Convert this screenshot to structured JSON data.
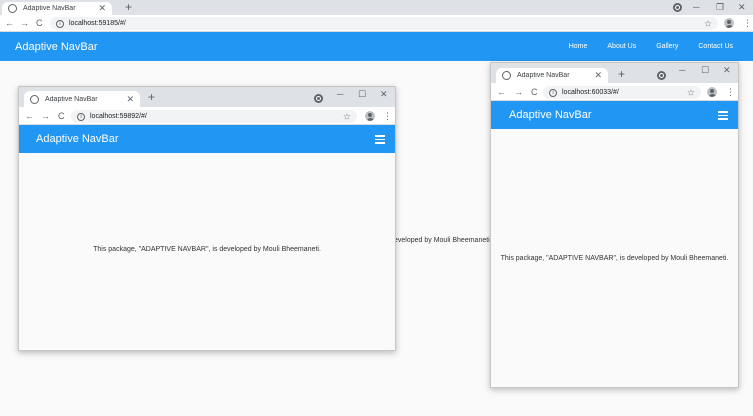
{
  "main": {
    "tab": {
      "title": "Adaptive NavBar",
      "close": "✕"
    },
    "new_tab": "+",
    "window_controls": {
      "minimize": "─",
      "maximize": "❐",
      "close": "✕"
    },
    "nav": {
      "back": "←",
      "forward": "→",
      "reload": "C"
    },
    "url": "localhost:59185/#/",
    "star": "☆",
    "kebab": "⋮",
    "brand": "Adaptive NavBar",
    "links": [
      "Home",
      "About Us",
      "Gallery",
      "Contact Us"
    ],
    "content_fragment": "eveloped by Mouli Bheemaneti."
  },
  "left_window": {
    "tab": {
      "title": "Adaptive NavBar",
      "close": "✕"
    },
    "new_tab": "+",
    "window_controls": {
      "minimize": "─",
      "maximize": "☐",
      "close": "✕"
    },
    "nav": {
      "back": "←",
      "forward": "→",
      "reload": "C"
    },
    "url": "localhost:59892/#/",
    "star": "☆",
    "kebab": "⋮",
    "brand": "Adaptive NavBar",
    "content": "This package, \"ADAPTIVE NAVBAR\", is developed by Mouli Bheemaneti."
  },
  "right_window": {
    "tab": {
      "title": "Adaptive NavBar",
      "close": "✕"
    },
    "new_tab": "+",
    "window_controls": {
      "minimize": "─",
      "maximize": "☐",
      "close": "✕"
    },
    "nav": {
      "back": "←",
      "forward": "→",
      "reload": "C"
    },
    "url": "localhost:60033/#/",
    "star": "☆",
    "kebab": "⋮",
    "brand": "Adaptive NavBar",
    "content": "This package, \"ADAPTIVE NAVBAR\", is developed by Mouli Bheemaneti."
  },
  "colors": {
    "navbar": "#2196f3",
    "page_bg": "#fafafa",
    "chrome_bg": "#dee1e6"
  },
  "icons": [
    "globe-icon",
    "close-icon",
    "plus-icon",
    "account-circle-icon",
    "minimize-icon",
    "maximize-icon",
    "back-arrow-icon",
    "forward-arrow-icon",
    "reload-icon",
    "info-icon",
    "star-icon",
    "profile-icon",
    "more-vert-icon",
    "hamburger-icon"
  ]
}
